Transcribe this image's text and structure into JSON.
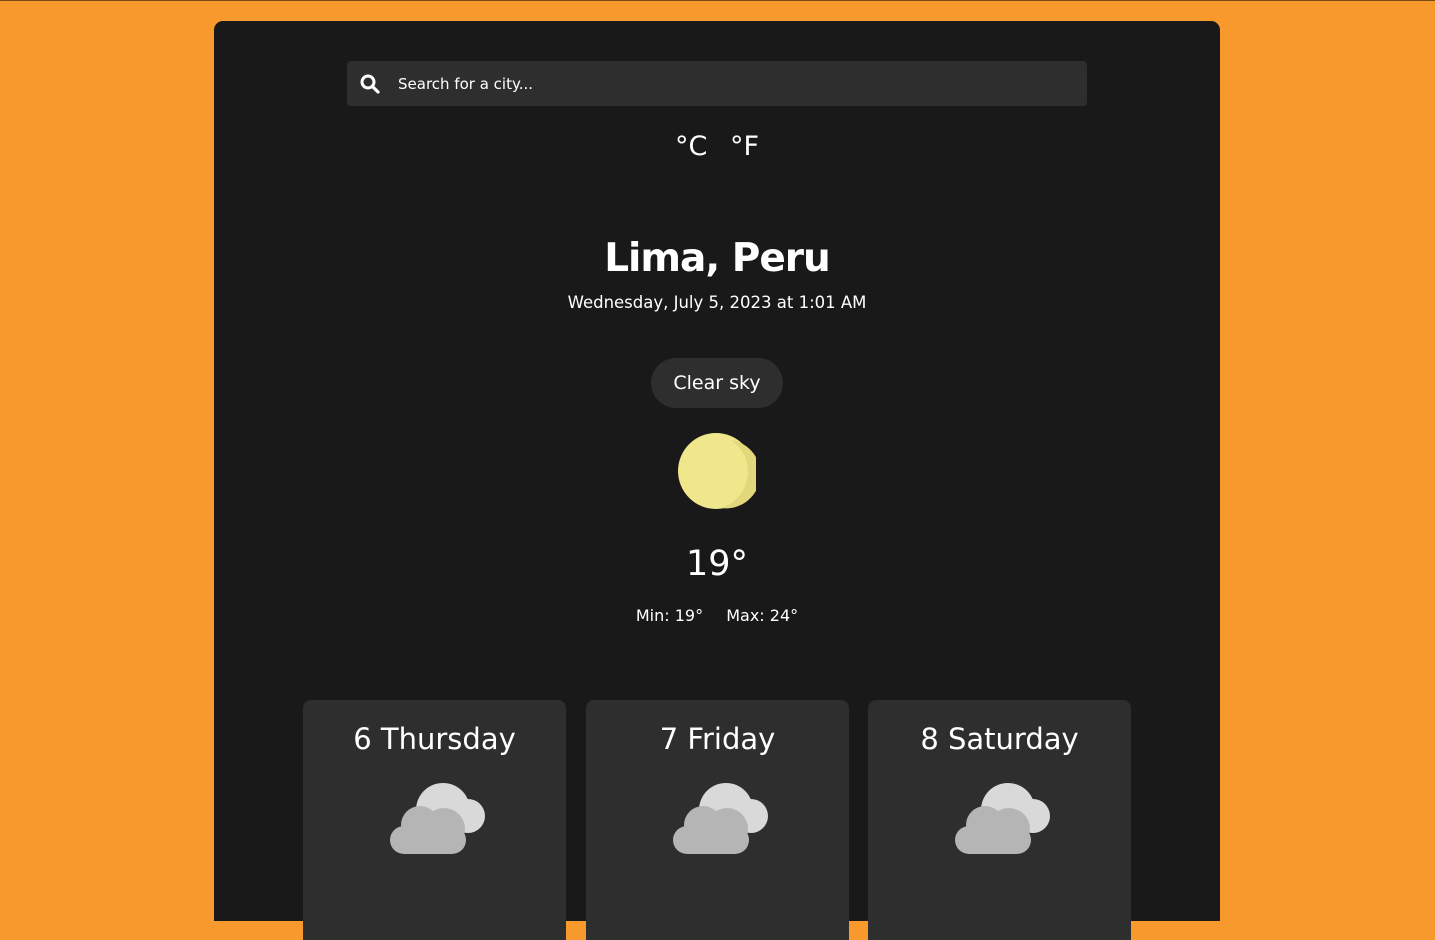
{
  "search": {
    "placeholder": "Search for a city..."
  },
  "units": {
    "celsius": "°C",
    "fahrenheit": "°F"
  },
  "location": {
    "name": "Lima, Peru"
  },
  "datetime": "Wednesday, July 5, 2023 at 1:01 AM",
  "current": {
    "condition": "Clear sky",
    "icon": "sun-icon",
    "temperature": "19°",
    "min": "Min: 19°",
    "max": "Max: 24°"
  },
  "forecast": [
    {
      "day": "6 Thursday",
      "icon": "cloud-icon"
    },
    {
      "day": "7 Friday",
      "icon": "cloud-icon"
    },
    {
      "day": "8 Saturday",
      "icon": "cloud-icon"
    }
  ],
  "colors": {
    "background": "#f7992c",
    "panel": "#191919",
    "surface": "#2e2e2e",
    "sun": "#f0e68c",
    "cloud": "#b5b5b5"
  }
}
